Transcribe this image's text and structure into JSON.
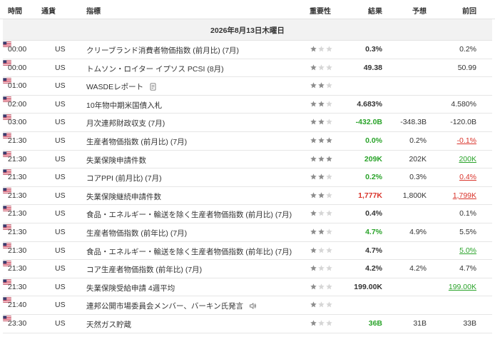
{
  "header": {
    "time": "時間",
    "currency": "通貨",
    "indicator": "指標",
    "importance": "重要性",
    "actual": "結果",
    "forecast": "予想",
    "previous": "前回"
  },
  "date_label": "2026年8月13日木曜日",
  "colors": {
    "up": "#2aa32a",
    "down": "#d9342b",
    "star_on": "#8c8c8c",
    "star_off": "#d6d6d6"
  },
  "rows": [
    {
      "time": "00:00",
      "currency": "US",
      "name": "クリーブランド消費者物価指数 (前月比) (7月)",
      "stars": 1,
      "actual": "0.3%",
      "actual_trend": "neu",
      "forecast": "",
      "previous": "0.2%",
      "previous_trend": "neu",
      "icon": ""
    },
    {
      "time": "00:00",
      "currency": "US",
      "name": "トムソン・ロイター イプソス PCSI (8月)",
      "stars": 1,
      "actual": "49.38",
      "actual_trend": "neu",
      "forecast": "",
      "previous": "50.99",
      "previous_trend": "neu",
      "icon": ""
    },
    {
      "time": "01:00",
      "currency": "US",
      "name": "WASDEレポート",
      "stars": 2,
      "actual": "",
      "actual_trend": "neu",
      "forecast": "",
      "previous": "",
      "previous_trend": "neu",
      "icon": "document-icon"
    },
    {
      "time": "02:00",
      "currency": "US",
      "name": "10年物中期米国債入札",
      "stars": 2,
      "actual": "4.683%",
      "actual_trend": "neu",
      "forecast": "",
      "previous": "4.580%",
      "previous_trend": "neu",
      "icon": ""
    },
    {
      "time": "03:00",
      "currency": "US",
      "name": "月次連邦財政収支 (7月)",
      "stars": 2,
      "actual": "-432.0B",
      "actual_trend": "up",
      "forecast": "-348.3B",
      "previous": "-120.0B",
      "previous_trend": "neu",
      "icon": ""
    },
    {
      "time": "21:30",
      "currency": "US",
      "name": "生産者物価指数 (前月比) (7月)",
      "stars": 3,
      "actual": "0.0%",
      "actual_trend": "up",
      "forecast": "0.2%",
      "previous": "-0.1%",
      "previous_trend": "down",
      "icon": ""
    },
    {
      "time": "21:30",
      "currency": "US",
      "name": "失業保険申請件数",
      "stars": 3,
      "actual": "209K",
      "actual_trend": "up",
      "forecast": "202K",
      "previous": "200K",
      "previous_trend": "up",
      "icon": ""
    },
    {
      "time": "21:30",
      "currency": "US",
      "name": "コアPPI (前月比) (7月)",
      "stars": 2,
      "actual": "0.2%",
      "actual_trend": "up",
      "forecast": "0.3%",
      "previous": "0.4%",
      "previous_trend": "down",
      "icon": ""
    },
    {
      "time": "21:30",
      "currency": "US",
      "name": "失業保険継続申請件数",
      "stars": 2,
      "actual": "1,777K",
      "actual_trend": "down",
      "forecast": "1,800K",
      "previous": "1,799K",
      "previous_trend": "down",
      "icon": ""
    },
    {
      "time": "21:30",
      "currency": "US",
      "name": "食品・エネルギー・輸送を除く生産者物価指数 (前月比) (7月)",
      "stars": 1,
      "actual": "0.4%",
      "actual_trend": "neu",
      "forecast": "",
      "previous": "0.1%",
      "previous_trend": "neu",
      "icon": ""
    },
    {
      "time": "21:30",
      "currency": "US",
      "name": "生産者物価指数 (前年比) (7月)",
      "stars": 2,
      "actual": "4.7%",
      "actual_trend": "up",
      "forecast": "4.9%",
      "previous": "5.5%",
      "previous_trend": "neu",
      "icon": ""
    },
    {
      "time": "21:30",
      "currency": "US",
      "name": "食品・エネルギー・輸送を除く生産者物価指数 (前年比) (7月)",
      "stars": 1,
      "actual": "4.7%",
      "actual_trend": "neu",
      "forecast": "",
      "previous": "5.0%",
      "previous_trend": "up",
      "icon": ""
    },
    {
      "time": "21:30",
      "currency": "US",
      "name": "コア生産者物価指数 (前年比) (7月)",
      "stars": 1,
      "actual": "4.2%",
      "actual_trend": "neu",
      "forecast": "4.2%",
      "previous": "4.7%",
      "previous_trend": "neu",
      "icon": ""
    },
    {
      "time": "21:30",
      "currency": "US",
      "name": "失業保険受給申請 4週平均",
      "stars": 1,
      "actual": "199.00K",
      "actual_trend": "neu",
      "forecast": "",
      "previous": "199.00K",
      "previous_trend": "up",
      "icon": ""
    },
    {
      "time": "21:40",
      "currency": "US",
      "name": "連邦公開市場委員会メンバー、バーキン氏発言",
      "stars": 1,
      "actual": "",
      "actual_trend": "neu",
      "forecast": "",
      "previous": "",
      "previous_trend": "neu",
      "icon": "speaker-icon"
    },
    {
      "time": "23:30",
      "currency": "US",
      "name": "天然ガス貯蔵",
      "stars": 1,
      "actual": "36B",
      "actual_trend": "up",
      "forecast": "31B",
      "previous": "33B",
      "previous_trend": "neu",
      "icon": ""
    }
  ]
}
